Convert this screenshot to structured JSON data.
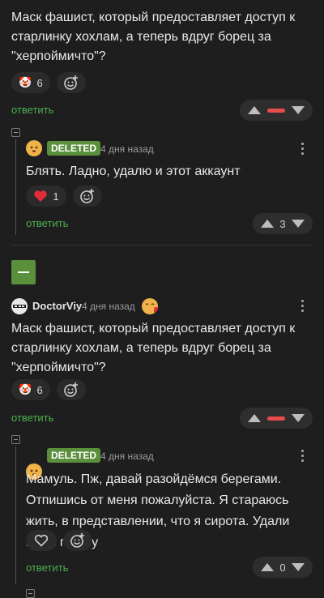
{
  "comment1": {
    "text": "Маск фашист, который предоставляет доступ к старлинку хохлам, а теперь вдруг борец за \"херпоймичто\"?",
    "reaction_count": "6",
    "reply_label": "ответить"
  },
  "reply1": {
    "badge": "DELETED",
    "time": "4 дня назад",
    "text": "Блять. Ладно, удалю и этот аккаунт",
    "like_count": "1",
    "rating": "3",
    "reply_label": "ответить"
  },
  "comment2": {
    "author": "DoctorViy",
    "time": "4 дня назад",
    "text": "Маск фашист, который предоставляет доступ к старлинку хохлам, а теперь вдруг борец за \"херпоймичто\"?",
    "reaction_count": "6",
    "reply_label": "ответить"
  },
  "reply2": {
    "badge": "DELETED",
    "time": "4 дня назад",
    "text": "Мамуль. Пж, давай разойдёмся берегами. Отпишись от меня пожалуйста. Я стараюсь жить, в представлении, что я сирота. Удали меня прошу",
    "rating": "0",
    "reply_label": "ответить"
  },
  "colors": {
    "background": "#1e1e1e",
    "accent_green": "#4caf50",
    "badge_green": "#5a8f3c",
    "downvote_red": "#e84c4c",
    "heart_red": "#e02b3a"
  }
}
